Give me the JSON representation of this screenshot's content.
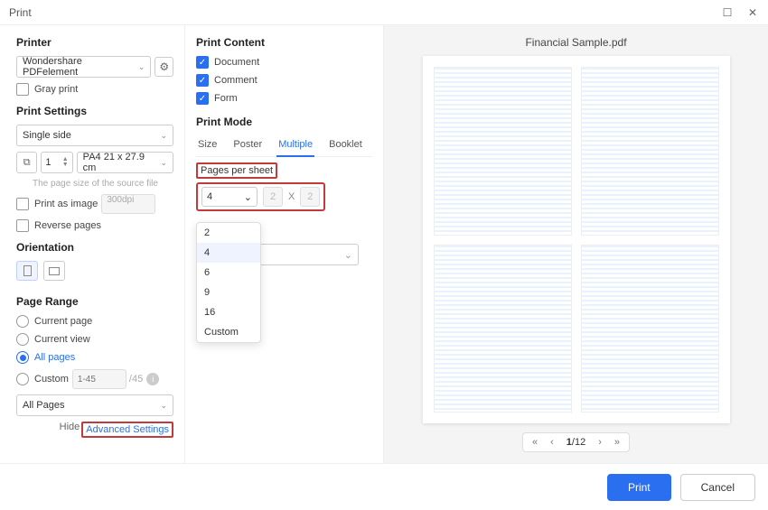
{
  "window": {
    "title": "Print"
  },
  "printer": {
    "heading": "Printer",
    "selected": "Wondershare PDFelement",
    "gray_print": "Gray print"
  },
  "print_settings": {
    "heading": "Print Settings",
    "sides": "Single side",
    "copies": "1",
    "paper": "PA4 21 x 27.9 cm",
    "source_size_hint": "The page size of the source file",
    "print_as_image": "Print as image",
    "print_as_image_dpi": "300dpi",
    "reverse_pages": "Reverse pages"
  },
  "orientation": {
    "heading": "Orientation"
  },
  "page_range": {
    "heading": "Page Range",
    "current_page": "Current page",
    "current_view": "Current view",
    "all_pages": "All pages",
    "custom": "Custom",
    "custom_placeholder": "1-45",
    "custom_total": "/45",
    "filter": "All Pages"
  },
  "advanced": {
    "hide": "Hide",
    "link": "Advanced Settings"
  },
  "print_content": {
    "heading": "Print Content",
    "document": "Document",
    "comment": "Comment",
    "form": "Form"
  },
  "print_mode": {
    "heading": "Print Mode",
    "tabs": {
      "size": "Size",
      "poster": "Poster",
      "multiple": "Multiple",
      "booklet": "Booklet"
    },
    "pps_label": "Pages per sheet",
    "pps_value": "4",
    "pps_x": "2",
    "pps_y": "2",
    "x": "X",
    "options": {
      "o2": "2",
      "o4": "4",
      "o6": "6",
      "o9": "9",
      "o16": "16",
      "custom": "Custom"
    }
  },
  "preview": {
    "filename": "Financial Sample.pdf",
    "page_current": "1",
    "page_total": "/12"
  },
  "footer": {
    "print": "Print",
    "cancel": "Cancel"
  }
}
